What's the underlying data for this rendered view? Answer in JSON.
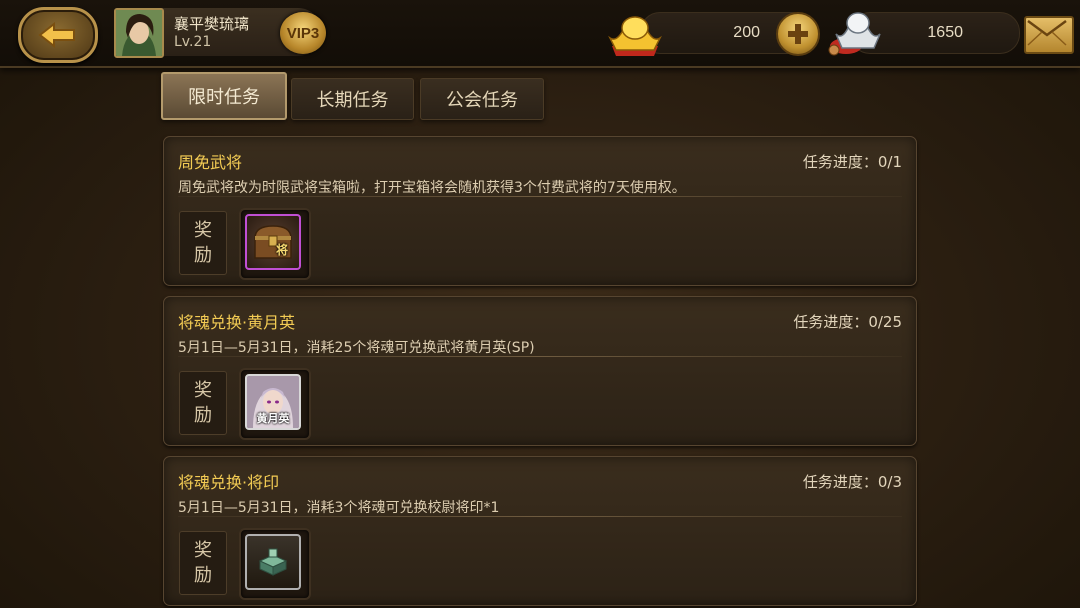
{
  "header": {
    "back_icon": "arrow-left-icon",
    "player": {
      "name": "襄平樊琉璃",
      "level": "Lv.21",
      "vip": "VIP3"
    },
    "currencies": {
      "gold": {
        "icon": "gold-ingot-icon",
        "value": "200"
      },
      "silver": {
        "icon": "silver-ingot-icon",
        "value": "1650"
      }
    },
    "add_icon": "plus-icon",
    "mail_icon": "envelope-icon"
  },
  "tabs": [
    {
      "label": "限时任务",
      "active": true
    },
    {
      "label": "长期任务",
      "active": false
    },
    {
      "label": "公会任务",
      "active": false
    }
  ],
  "tasks": [
    {
      "title": "周免武将",
      "progress": "任务进度：0/1",
      "description": "周免武将改为时限武将宝箱啦，打开宝箱将会随机获得3个付费武将的7天使用权。",
      "reward_label_1": "奖",
      "reward_label_2": "励",
      "reward": {
        "icon": "treasure-chest-icon",
        "label": "将"
      }
    },
    {
      "title": "将魂兑换·黄月英",
      "progress": "任务进度：0/25",
      "description": "5月1日—5月31日，消耗25个将魂可兑换武将黄月英(SP)",
      "reward_label_1": "奖",
      "reward_label_2": "励",
      "reward": {
        "icon": "hero-portrait-icon",
        "label": "黄月英"
      }
    },
    {
      "title": "将魂兑换·将印",
      "progress": "任务进度：0/3",
      "description": "5月1日—5月31日，消耗3个将魂可兑换校尉将印*1",
      "reward_label_1": "奖",
      "reward_label_2": "励",
      "reward": {
        "icon": "general-seal-icon"
      }
    }
  ],
  "colors": {
    "title_gold": "#f3cc54",
    "chest_border": "#c04fd4",
    "background": "#2d2012"
  }
}
